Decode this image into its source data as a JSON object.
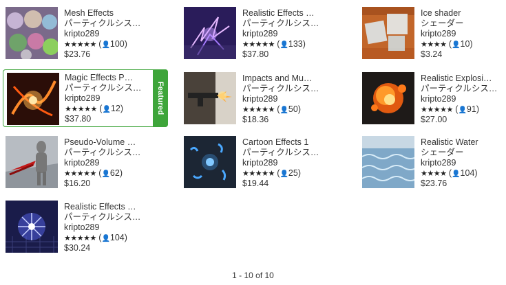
{
  "items": [
    {
      "title": "Mesh Effects",
      "category": "パーティクルシス…",
      "publisher": "kripto289",
      "stars": "★★★★★",
      "count": "100",
      "price": "$23.76",
      "featured": false
    },
    {
      "title": "Realistic Effects …",
      "category": "パーティクルシス…",
      "publisher": "kripto289",
      "stars": "★★★★★",
      "count": "133",
      "price": "$37.80",
      "featured": false
    },
    {
      "title": "Ice shader",
      "category": "シェーダー",
      "publisher": "kripto289",
      "stars": "★★★★",
      "count": "10",
      "price": "$3.24",
      "featured": false
    },
    {
      "title": "Magic Effects P…",
      "category": "パーティクルシス…",
      "publisher": "kripto289",
      "stars": "★★★★★",
      "count": "12",
      "price": "$37.80",
      "featured": true,
      "badge": "Featured"
    },
    {
      "title": "Impacts and Mu…",
      "category": "パーティクルシス…",
      "publisher": "kripto289",
      "stars": "★★★★★",
      "count": "50",
      "price": "$18.36",
      "featured": false
    },
    {
      "title": "Realistic Explosi…",
      "category": "パーティクルシス…",
      "publisher": "kripto289",
      "stars": "★★★★★",
      "count": "91",
      "price": "$27.00",
      "featured": false
    },
    {
      "title": "Pseudo-Volume …",
      "category": "パーティクルシス…",
      "publisher": "kripto289",
      "stars": "★★★★★",
      "count": "62",
      "price": "$16.20",
      "featured": false
    },
    {
      "title": "Cartoon Effects 1",
      "category": "パーティクルシス…",
      "publisher": "kripto289",
      "stars": "★★★★★",
      "count": "25",
      "price": "$19.44",
      "featured": false
    },
    {
      "title": "Realistic Water",
      "category": "シェーダー",
      "publisher": "kripto289",
      "stars": "★★★★",
      "count": "104",
      "price": "$23.76",
      "featured": false
    },
    {
      "title": "Realistic Effects …",
      "category": "パーティクルシス…",
      "publisher": "kripto289",
      "stars": "★★★★★",
      "count": "104",
      "price": "$30.24",
      "featured": false
    }
  ],
  "pagination": {
    "text": "1 - 10 of 10"
  },
  "colors": {
    "featured": "#3ea53a"
  },
  "icons": {
    "rating_count": "person-icon"
  }
}
